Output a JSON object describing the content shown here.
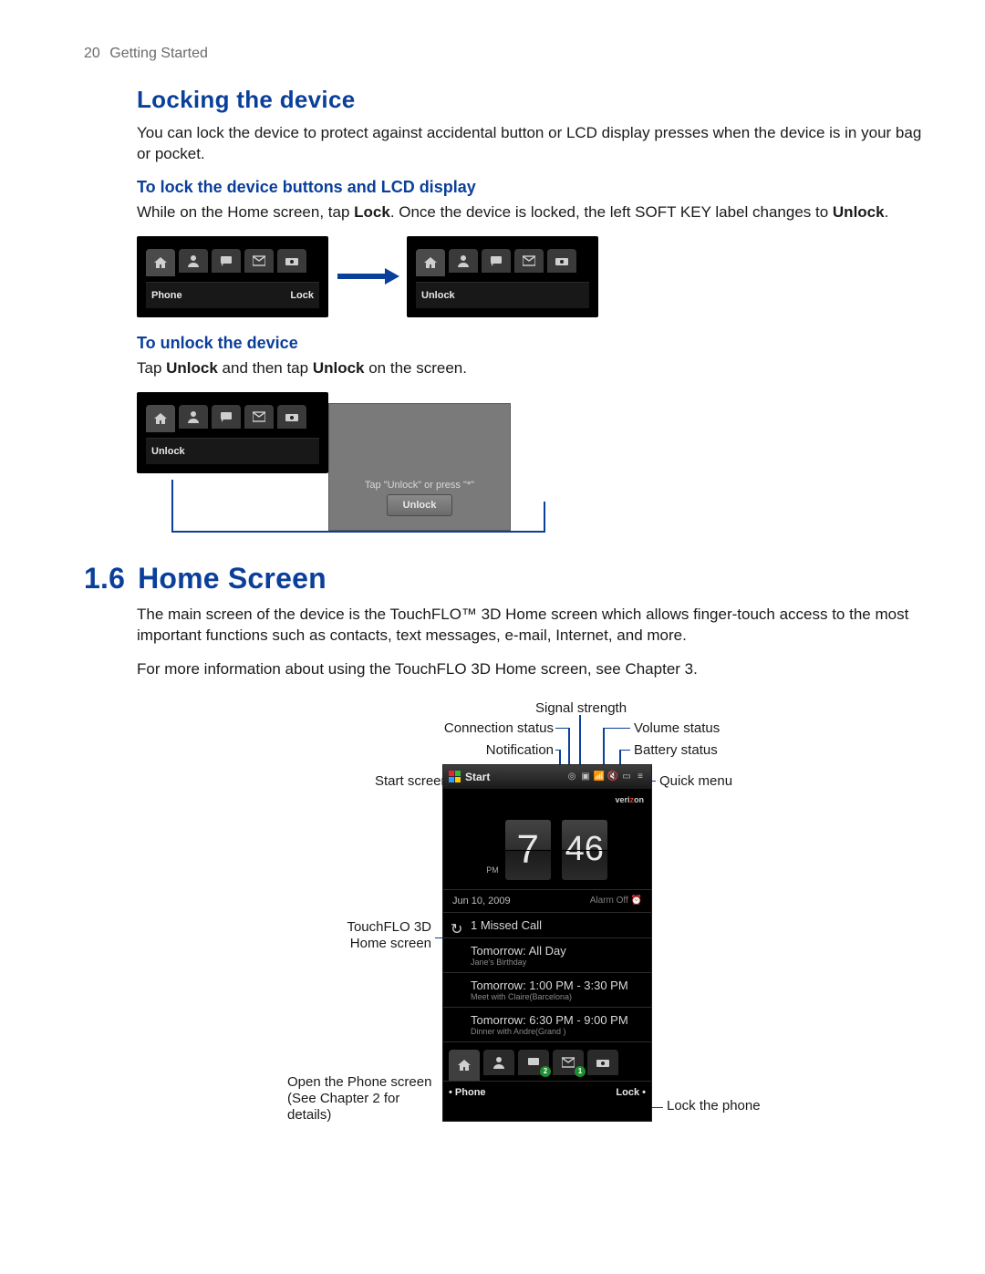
{
  "header": {
    "page_number": "20",
    "section": "Getting Started"
  },
  "locking": {
    "heading": "Locking the device",
    "intro": "You can lock the device to protect against accidental button or LCD display presses when the device is in your bag or pocket.",
    "lock": {
      "heading": "To lock the device buttons and LCD display",
      "text_pre": "While on the Home screen, tap ",
      "bold1": "Lock",
      "text_mid": ". Once the device is locked, the left SOFT KEY label changes to ",
      "bold2": "Unlock",
      "text_post": "."
    },
    "unlock": {
      "heading": "To unlock the device",
      "text_pre": "Tap ",
      "bold1": "Unlock",
      "text_mid": " and then tap ",
      "bold2": "Unlock",
      "text_post": " on the screen."
    },
    "bars": {
      "left": {
        "soft_left": "Phone",
        "soft_right": "Lock"
      },
      "right": {
        "soft_left": "Unlock",
        "soft_right": ""
      },
      "gray_hint": "Tap \"Unlock\" or press \"*\"",
      "gray_btn": "Unlock"
    }
  },
  "home": {
    "number": "1.6",
    "heading": "Home Screen",
    "p1": "The main screen of the device is the TouchFLO™ 3D Home screen which allows finger-touch access to the most important functions such as contacts, text messages, e-mail, Internet, and more.",
    "p2": "For more information about using the TouchFLO 3D Home screen, see Chapter 3.",
    "callouts": {
      "signal": "Signal strength",
      "conn": "Connection status",
      "vol": "Volume status",
      "notif": "Notification",
      "batt": "Battery status",
      "start": "Start screen",
      "quick": "Quick menu",
      "touchflo": "TouchFLO 3D\nHome screen",
      "open": "Open the Phone screen\n(See Chapter 2 for details)",
      "lockp": "Lock the phone"
    },
    "phone": {
      "start": "Start",
      "carrier_a": "veri",
      "carrier_b": "z",
      "carrier_c": "on",
      "pm": "PM",
      "hour": "7",
      "minute": "46",
      "date": "Jun 10, 2009",
      "alarm": "Alarm Off ⏰",
      "row1": "1 Missed Call",
      "row2_t": "Tomorrow: All Day",
      "row2_s": "Jane's Birthday",
      "row3_t": "Tomorrow: 1:00 PM - 3:30 PM",
      "row3_s": "Meet with Claire(Barcelona)",
      "row4_t": "Tomorrow: 6:30 PM - 9:00 PM",
      "row4_s": "Dinner with Andre(Grand )",
      "badge_people": "2",
      "badge_mail": "1",
      "soft_left": "Phone",
      "soft_right": "Lock"
    }
  }
}
